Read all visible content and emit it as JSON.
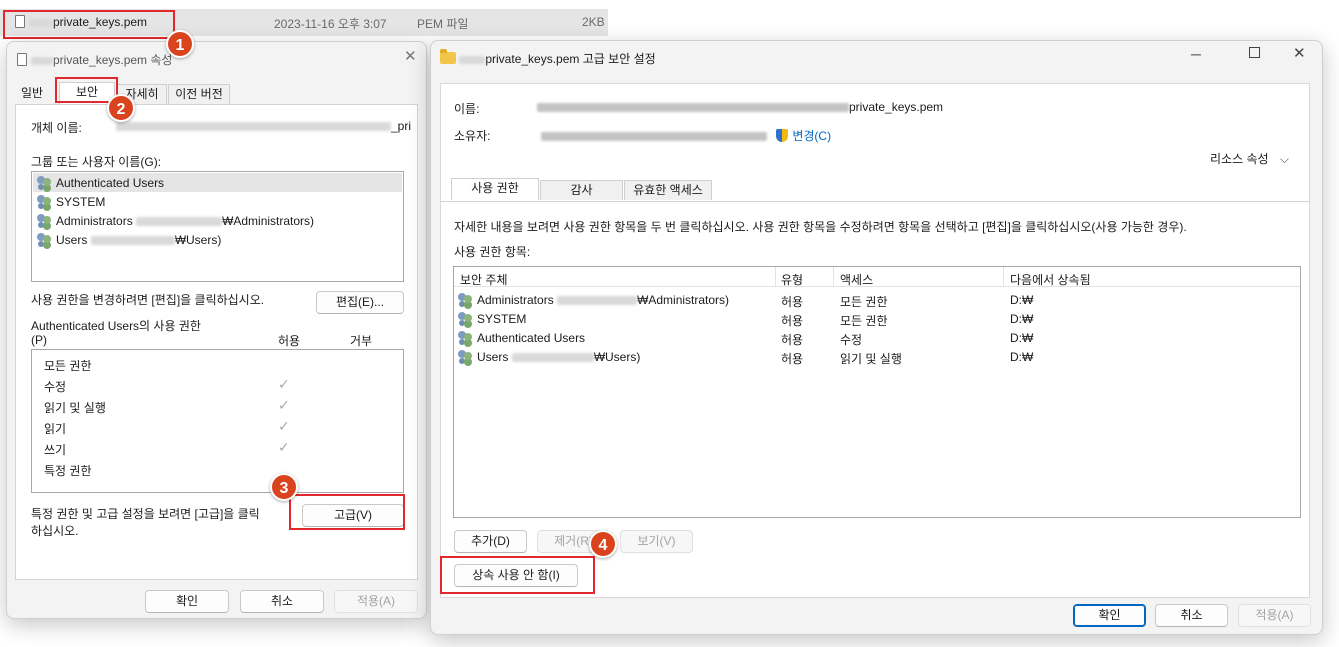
{
  "explorer": {
    "file_name": "private_keys.pem",
    "date": "2023-11-16 오후 3:07",
    "type": "PEM 파일",
    "size": "2KB"
  },
  "props": {
    "title_name": "private_keys.pem",
    "title_suffix": "속성",
    "tabs": [
      "일반",
      "보안",
      "자세히",
      "이전 버전"
    ],
    "object_label": "개체 이름:",
    "object_value_tail": "_pri",
    "group_label": "그룹 또는 사용자 이름(G):",
    "users": [
      {
        "name": "Authenticated Users",
        "suffix": ""
      },
      {
        "name": "SYSTEM",
        "suffix": ""
      },
      {
        "name": "Administrators",
        "suffix": "₩Administrators)"
      },
      {
        "name": "Users",
        "suffix": "₩Users)"
      }
    ],
    "edit_hint": "사용 권한을 변경하려면 [편집]을 클릭하십시오.",
    "edit_button": "편집(E)...",
    "perm_title_line1": "Authenticated Users의 사용 권한",
    "perm_title_line2": "(P)",
    "allow_col": "허용",
    "deny_col": "거부",
    "perms": [
      {
        "name": "모든 권한",
        "allow": false
      },
      {
        "name": "수정",
        "allow": true
      },
      {
        "name": "읽기 및 실행",
        "allow": true
      },
      {
        "name": "읽기",
        "allow": true
      },
      {
        "name": "쓰기",
        "allow": true
      },
      {
        "name": "특정 권한",
        "allow": false
      }
    ],
    "advanced_hint_line1": "특정 권한 및 고급 설정을 보려면 [고급]을 클릭",
    "advanced_hint_line2": "하십시오.",
    "advanced_button": "고급(V)",
    "ok": "확인",
    "cancel": "취소",
    "apply": "적용(A)"
  },
  "adv": {
    "title_name": "private_keys.pem",
    "title_suffix": "고급 보안 설정",
    "name_label": "이름:",
    "name_value_tail": "private_keys.pem",
    "owner_label": "소유자:",
    "change_link": "변경(C)",
    "resource_props": "리소스 속성",
    "tabs": [
      "사용 권한",
      "감사",
      "유효한 액세스"
    ],
    "info": "자세한 내용을 보려면 사용 권한 항목을 두 번 클릭하십시오. 사용 권한 항목을 수정하려면 항목을 선택하고 [편집]을 클릭하십시오(사용 가능한 경우).",
    "entries_label": "사용 권한 항목:",
    "columns": [
      "보안 주체",
      "유형",
      "액세스",
      "다음에서 상속됨"
    ],
    "rows": [
      {
        "principal": "Administrators",
        "suffix": "₩Administrators)",
        "type": "허용",
        "access": "모든 권한",
        "inherited": "D:₩"
      },
      {
        "principal": "SYSTEM",
        "suffix": "",
        "type": "허용",
        "access": "모든 권한",
        "inherited": "D:₩"
      },
      {
        "principal": "Authenticated Users",
        "suffix": "",
        "type": "허용",
        "access": "수정",
        "inherited": "D:₩"
      },
      {
        "principal": "Users",
        "suffix": "₩Users)",
        "type": "허용",
        "access": "읽기 및 실행",
        "inherited": "D:₩"
      }
    ],
    "add_button": "추가(D)",
    "remove_button": "제거(R)",
    "view_button": "보기(V)",
    "disable_inherit_button": "상속 사용 안 함(I)",
    "ok": "확인",
    "cancel": "취소",
    "apply": "적용(A)"
  },
  "markers": [
    "1",
    "2",
    "3",
    "4"
  ],
  "colors": {
    "marker": "#d9441f",
    "highlight_box": "#e0282d",
    "link": "#0067c0"
  }
}
